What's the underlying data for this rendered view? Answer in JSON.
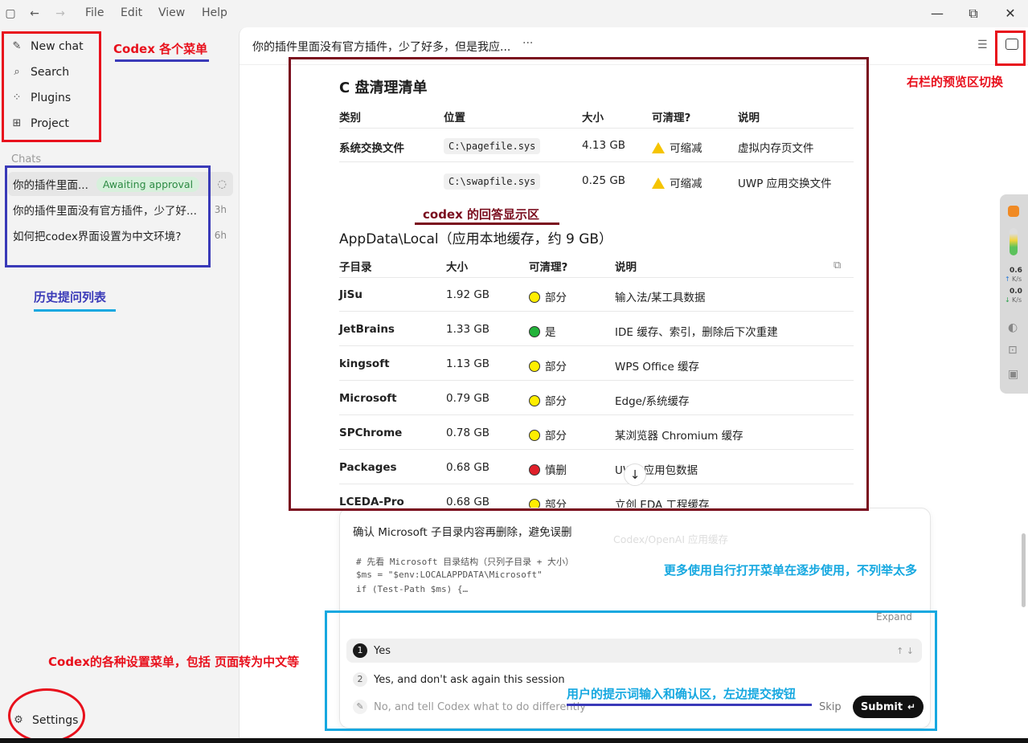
{
  "titlebar": {
    "menus": [
      "File",
      "Edit",
      "View",
      "Help"
    ],
    "minimize": "—",
    "restore": "⧉",
    "close": "✕"
  },
  "sidebar": {
    "nav": [
      {
        "label": "New chat",
        "icon": "edit-icon"
      },
      {
        "label": "Search",
        "icon": "search-icon"
      },
      {
        "label": "Plugins",
        "icon": "plugins-icon"
      },
      {
        "label": "Project",
        "icon": "project-icon"
      }
    ],
    "chats_header": "Chats",
    "chats": [
      {
        "title": "你的插件里面...",
        "badge": "Awaiting approval",
        "time": ""
      },
      {
        "title": "你的插件里面没有官方插件，少了好...",
        "time": "3h"
      },
      {
        "title": "如何把codex界面设置为中文环境?",
        "time": "6h"
      }
    ],
    "settings_label": "Settings"
  },
  "main": {
    "chat_title": "你的插件里面没有官方插件，少了好多，但是我应...",
    "more": "···",
    "section1": {
      "title": "C 盘清理清单",
      "headers": [
        "类别",
        "位置",
        "大小",
        "可清理?",
        "说明"
      ],
      "rows": [
        {
          "category": "系统交换文件",
          "path": "C:\\pagefile.sys",
          "size": "4.13 GB",
          "clean": "可缩减",
          "note": "虚拟内存页文件"
        },
        {
          "category": "",
          "path": "C:\\swapfile.sys",
          "size": "0.25 GB",
          "clean": "可缩减",
          "note": "UWP 应用交换文件"
        }
      ]
    },
    "section2": {
      "title": "AppData\\Local（应用本地缓存，约 9 GB）",
      "headers": [
        "子目录",
        "大小",
        "可清理?",
        "说明"
      ],
      "rows": [
        {
          "dir": "JiSu",
          "size": "1.92 GB",
          "clean": "部分",
          "color": "#ffee00",
          "note": "输入法/某工具数据"
        },
        {
          "dir": "JetBrains",
          "size": "1.33 GB",
          "clean": "是",
          "color": "#22b33a",
          "note": "IDE 缓存、索引，删除后下次重建"
        },
        {
          "dir": "kingsoft",
          "size": "1.13 GB",
          "clean": "部分",
          "color": "#ffee00",
          "note": "WPS Office 缓存"
        },
        {
          "dir": "Microsoft",
          "size": "0.79 GB",
          "clean": "部分",
          "color": "#ffee00",
          "note": "Edge/系统缓存"
        },
        {
          "dir": "SPChrome",
          "size": "0.78 GB",
          "clean": "部分",
          "color": "#ffee00",
          "note": "某浏览器 Chromium 缓存"
        },
        {
          "dir": "Packages",
          "size": "0.68 GB",
          "clean": "慎删",
          "color": "#e0202a",
          "note": "UWP 应用包数据"
        },
        {
          "dir": "LCEDA-Pro",
          "size": "0.68 GB",
          "clean": "部分",
          "color": "#ffee00",
          "note": "立创 EDA 工程缓存"
        }
      ]
    },
    "card": {
      "title": "确认 Microsoft 子目录内容再删除，避免误删",
      "code": [
        "# 先看 Microsoft 目录结构（只列子目录 + 大小）",
        "$ms = \"$env:LOCALAPPDATA\\Microsoft\"",
        "if (Test-Path $ms) {…"
      ],
      "expand": "Expand",
      "options": [
        {
          "num": "1",
          "label": "Yes"
        },
        {
          "num": "2",
          "label": "Yes, and don't ask again this session"
        }
      ],
      "input_placeholder": "No, and tell Codex what to do differently",
      "skip": "Skip",
      "submit": "Submit",
      "ghost": "Codex/OpenAI 应用缓存"
    }
  },
  "widget": {
    "up": "0.6",
    "up_unit": "K/s",
    "down": "0.0",
    "down_unit": "K/s"
  },
  "annotations": {
    "menus": "Codex 各个菜单",
    "history": "历史提问列表",
    "answer": "codex 的回答显示区",
    "preview": "右栏的预览区切换",
    "more_menus": "更多使用自行打开菜单在逐步使用，不列举太多",
    "settings": "Codex的各种设置菜单，包括 页面转为中文等",
    "input": "用户的提示词输入和确认区，左边提交按钮"
  },
  "colors": {
    "ann_red": "#e8101c",
    "ann_blue": "#3a3ab8",
    "ann_maroon": "#7a0d1e",
    "ann_cyan": "#16a8e0"
  }
}
